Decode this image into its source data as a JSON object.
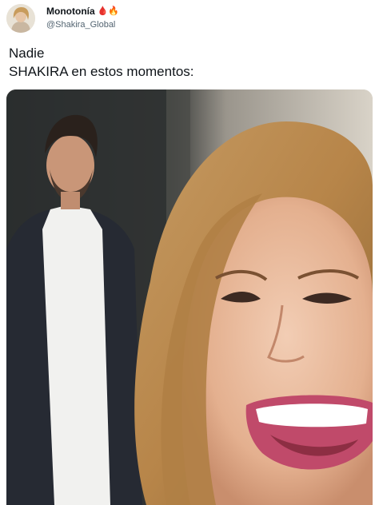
{
  "author": {
    "display_name": "Monotonía",
    "emojis": "🩸🔥",
    "handle": "@Shakira_Global",
    "avatar_icon": "profile-avatar"
  },
  "tweet": {
    "lines": [
      "Nadie",
      "SHAKIRA en estos momentos:"
    ]
  },
  "media": {
    "type": "video-still",
    "icon": "photo-media"
  }
}
